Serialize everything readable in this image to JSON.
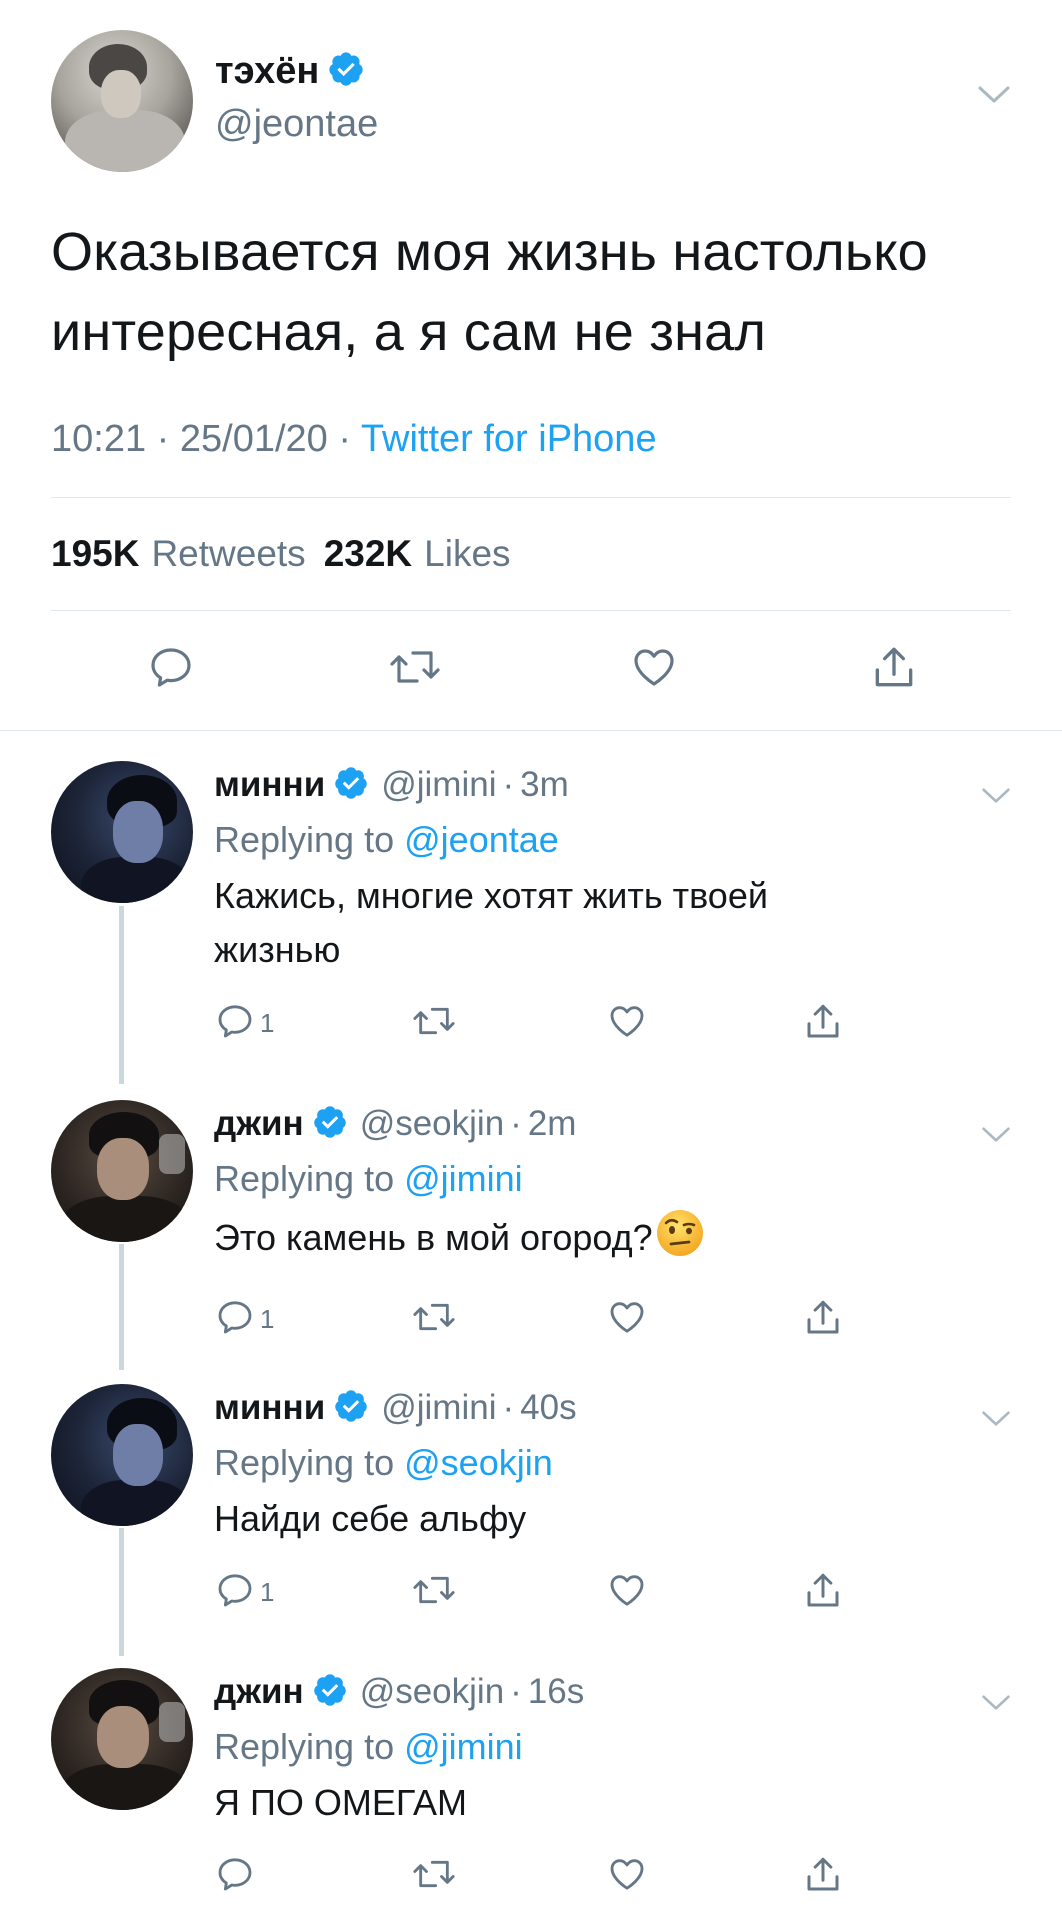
{
  "main_tweet": {
    "name": "тэхён",
    "handle": "@jeontae",
    "text_line1": "Оказывается моя жизнь настолько",
    "text_line2": "интересная, а я сам не знал",
    "time": "10:21",
    "date": "25/01/20",
    "dot": "·",
    "source": "Twitter for iPhone",
    "retweets_count": "195K",
    "retweets_label": "Retweets",
    "likes_count": "232K",
    "likes_label": "Likes"
  },
  "replies": [
    {
      "name": "минни",
      "handle": "@jimini",
      "time": "3m",
      "replying_label": "Replying to",
      "replying_to": "@jeontae",
      "text_line1": "Кажись, многие хотят жить твоей",
      "text_line2": "жизнью",
      "reply_count": "1"
    },
    {
      "name": "джин",
      "handle": "@seokjin",
      "time": "2m",
      "replying_label": "Replying to",
      "replying_to": "@jimini",
      "text": "Это камень в мой огород?",
      "emoji": "face-with-raised-eyebrow",
      "reply_count": "1"
    },
    {
      "name": "минни",
      "handle": "@jimini",
      "time": "40s",
      "replying_label": "Replying to",
      "replying_to": "@seokjin",
      "text": "Найди себе альфу",
      "reply_count": "1"
    },
    {
      "name": "джин",
      "handle": "@seokjin",
      "time": "16s",
      "replying_label": "Replying to",
      "replying_to": "@jimini",
      "text": "Я ПО ОМЕГАМ",
      "reply_count": ""
    }
  ],
  "colors": {
    "accent": "#1da1f2",
    "secondary_text": "#657786",
    "separator": "#e1e8ed",
    "thread_line": "#ccd6dd"
  }
}
